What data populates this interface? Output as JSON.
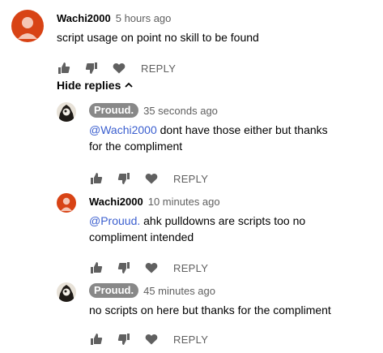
{
  "comments": [
    {
      "author": "Wachi2000",
      "time": "5 hours ago",
      "text": "script usage on point no skill to be found",
      "reply_label": "REPLY"
    }
  ],
  "hide_replies_label": "Hide replies",
  "replies": [
    {
      "author": "Prouud.",
      "time": "35 seconds ago",
      "mention": "@Wachi2000",
      "text": " dont have those either but thanks for the compliment",
      "reply_label": "REPLY"
    },
    {
      "author": "Wachi2000",
      "time": "10 minutes ago",
      "mention": "@Prouud.",
      "text": " ahk pulldowns are scripts too no compliment intended",
      "reply_label": "REPLY"
    },
    {
      "author": "Prouud.",
      "time": "45 minutes ago",
      "text": "no scripts on here but thanks for the compliment",
      "reply_label": "REPLY"
    }
  ],
  "colors": {
    "wachi_avatar": "#d84315",
    "prouud_badge": "#888888",
    "mention": "#3b5fcf",
    "icon": "#606060"
  },
  "icons": [
    "thumb-up-icon",
    "thumb-down-icon",
    "heart-icon",
    "chevron-up-icon"
  ]
}
